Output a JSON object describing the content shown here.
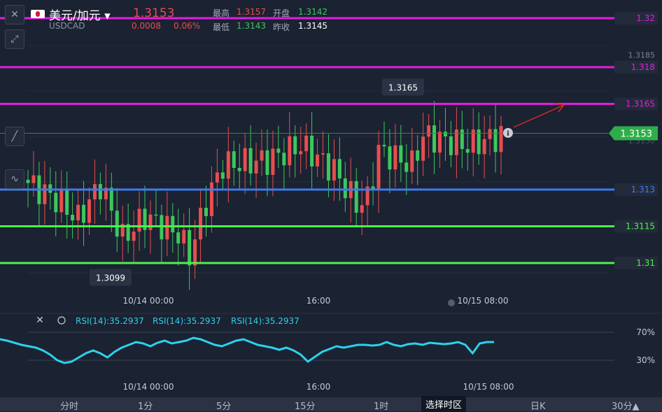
{
  "header": {
    "pair": "美元/加元",
    "symbol": "USDCAD",
    "last": "1.3153",
    "change": "0.0008",
    "change_pct": "0.06%",
    "high_label": "最高",
    "high": "1.3157",
    "open_label": "开盘",
    "open": "1.3142",
    "low_label": "最低",
    "low": "1.3143",
    "prev_label": "昨收",
    "prev": "1.3145"
  },
  "colors": {
    "up": "#e64e4e",
    "down": "#3cc85c",
    "magenta": "#e01ee0",
    "blue": "#3d7cf0",
    "lime": "#4cf04c",
    "rsi": "#2bd2ec"
  },
  "icons": [
    "close-icon",
    "expand-icon",
    "draw-icon",
    "line-chart-icon",
    "eye-icon",
    "chevron-down-icon",
    "info-icon"
  ],
  "chart_data": {
    "type": "candlestick",
    "ylim": [
      1.3095,
      1.3205
    ],
    "y_ticks": [
      "1.3185",
      "1.3150"
    ],
    "x_ticks": [
      "10/14 00:00",
      "16:00",
      "10/15 08:00"
    ],
    "current_price": "1.3153",
    "horizontal_lines": [
      {
        "value": 1.32,
        "label": "1.32",
        "color": "#e01ee0"
      },
      {
        "value": 1.318,
        "label": "1.318",
        "color": "#e01ee0"
      },
      {
        "value": 1.3165,
        "label": "1.3165",
        "color": "#e01ee0"
      },
      {
        "value": 1.313,
        "label": "1.313",
        "color": "#3d7cf0"
      },
      {
        "value": 1.3115,
        "label": "1.3115",
        "color": "#4cf04c"
      },
      {
        "value": 1.31,
        "label": "1.31",
        "color": "#4cf04c"
      }
    ],
    "annotations": [
      {
        "label": "1.3165",
        "value": 1.3165
      },
      {
        "label": "1.3099",
        "value": 1.3099
      }
    ],
    "rsi": {
      "label": "RSI(14):35.2937",
      "levels": [
        "70%",
        "30%"
      ],
      "values": [
        60,
        58,
        55,
        52,
        50,
        48,
        44,
        38,
        30,
        26,
        28,
        34,
        40,
        44,
        40,
        34,
        42,
        48,
        52,
        56,
        54,
        50,
        55,
        58,
        54,
        56,
        58,
        62,
        60,
        56,
        52,
        50,
        54,
        58,
        60,
        56,
        52,
        50,
        48,
        45,
        48,
        44,
        38,
        28,
        35,
        42,
        46,
        50,
        48,
        50,
        52,
        52,
        51,
        52,
        56,
        52,
        50,
        53,
        54,
        52,
        55,
        54,
        53,
        54,
        56,
        52,
        40,
        54,
        56,
        56
      ]
    },
    "timeframes": [
      "分时",
      "1分",
      "5分",
      "15分",
      "1时",
      "选择时区",
      "日K",
      "30分▲"
    ]
  }
}
